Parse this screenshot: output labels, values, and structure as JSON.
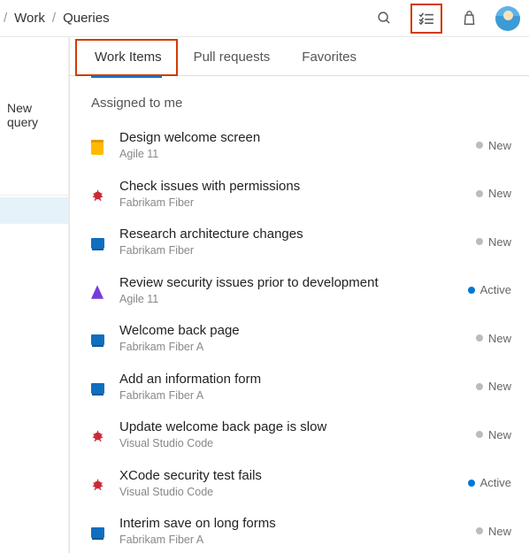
{
  "breadcrumb": {
    "item1": "Work",
    "item2": "Queries"
  },
  "left": {
    "new_query": "New query"
  },
  "tabs": {
    "work_items": "Work Items",
    "pull_requests": "Pull requests",
    "favorites": "Favorites"
  },
  "group_header": "Assigned to me",
  "status_labels": {
    "new": "New",
    "active": "Active"
  },
  "items": [
    {
      "type": "epic",
      "title": "Design welcome screen",
      "project": "Agile 11",
      "status": "new"
    },
    {
      "type": "bug",
      "title": "Check issues with permissions",
      "project": "Fabrikam Fiber",
      "status": "new"
    },
    {
      "type": "feature",
      "title": "Research architecture changes",
      "project": "Fabrikam Fiber",
      "status": "new"
    },
    {
      "type": "issue",
      "title": "Review security issues prior to development",
      "project": "Agile 11",
      "status": "active"
    },
    {
      "type": "feature",
      "title": "Welcome back page",
      "project": "Fabrikam Fiber A",
      "status": "new"
    },
    {
      "type": "feature",
      "title": "Add an information form",
      "project": "Fabrikam Fiber A",
      "status": "new"
    },
    {
      "type": "bug",
      "title": "Update welcome back page is slow",
      "project": "Visual Studio Code",
      "status": "new"
    },
    {
      "type": "bug",
      "title": "XCode security test fails",
      "project": "Visual Studio Code",
      "status": "active"
    },
    {
      "type": "feature",
      "title": "Interim save on long forms",
      "project": "Fabrikam Fiber A",
      "status": "new"
    }
  ]
}
